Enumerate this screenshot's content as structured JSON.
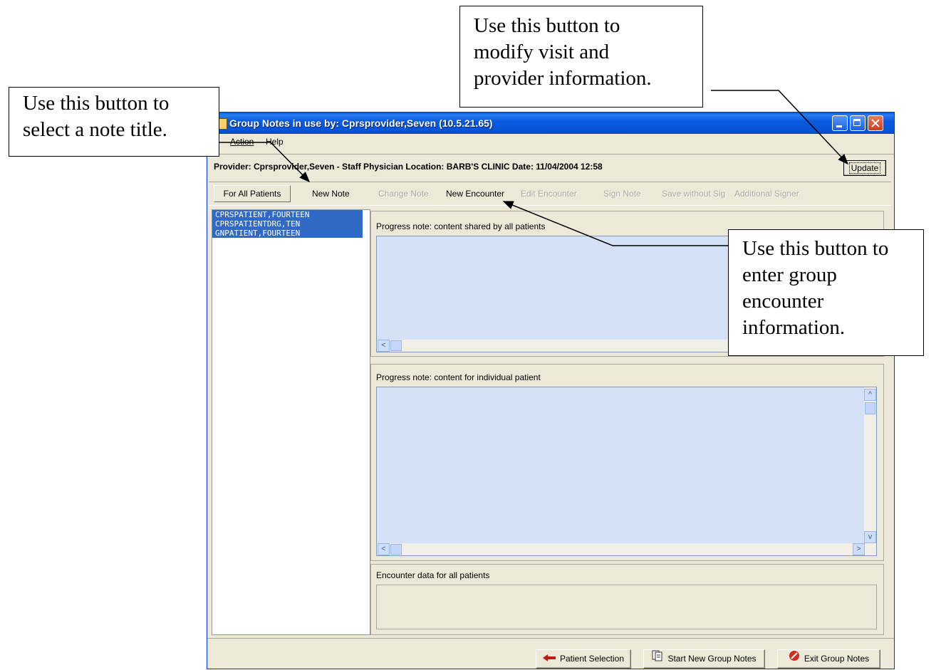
{
  "window": {
    "title": "Group Notes in use by: Cprsprovider,Seven  (10.5.21.65)"
  },
  "menu": [
    "ile",
    "Action",
    "Help"
  ],
  "provider_bar": {
    "text": "Provider: Cprsprovider,Seven - Staff Physician  Location: BARB'S CLINIC  Date: 11/04/2004 12:58",
    "update_label": "Update"
  },
  "toolbar": {
    "for_all_patients": "For All Patients",
    "new_note": "New Note",
    "change_note": "Change Note",
    "new_encounter": "New Encounter",
    "edit_encounter": "Edit Encounter",
    "sign_note": "Sign Note",
    "save_without_sig": "Save without Sig",
    "additional_signer": "Additional Signer"
  },
  "patients": [
    "CPRSPATIENT,FOURTEEN",
    "CPRSPATIENTDRG,TEN",
    "GNPATIENT,FOURTEEN"
  ],
  "panes": {
    "shared_label": "Progress note:  content shared by all patients",
    "individual_label": "Progress note:  content for individual patient",
    "encounter_label": "Encounter data for all patients"
  },
  "bottom_buttons": {
    "patient_selection": "Patient Selection",
    "start_new": "Start New Group Notes",
    "exit": "Exit Group Notes"
  },
  "callouts": {
    "note_title": [
      "Use this button to",
      "select a note title."
    ],
    "update": [
      "Use this button to",
      "modify visit and",
      "provider information."
    ],
    "encounter": [
      "Use this button to",
      "enter group",
      "encounter",
      "information."
    ]
  }
}
